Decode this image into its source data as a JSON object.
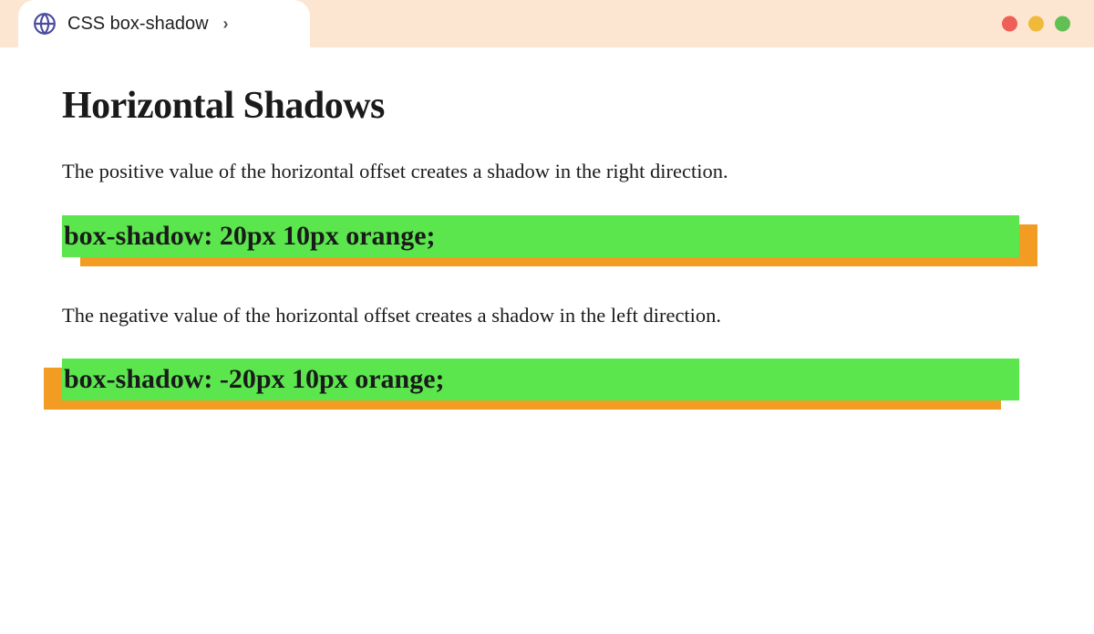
{
  "tab": {
    "title": "CSS box-shadow"
  },
  "page": {
    "heading": "Horizontal Shadows",
    "desc_positive": "The positive value of the horizontal offset creates a shadow in the right direction.",
    "box_positive": "box-shadow: 20px 10px orange;",
    "desc_negative": "The negative value of the horizontal offset creates a shadow in the left direction.",
    "box_negative": "box-shadow: -20px 10px orange;"
  }
}
